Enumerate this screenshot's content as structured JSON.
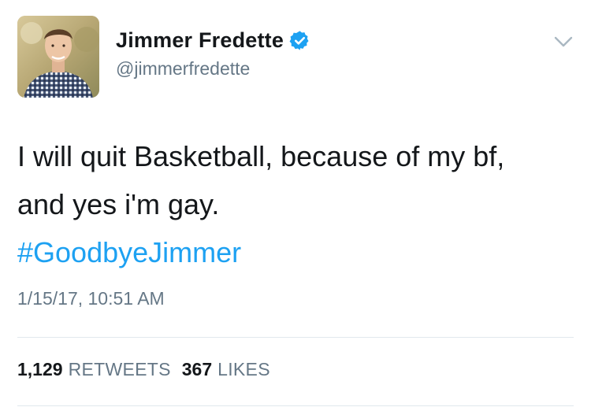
{
  "author": {
    "display_name": "Jimmer Fredette",
    "handle": "@jimmerfredette",
    "verified": true,
    "avatar_icon": "profile-photo"
  },
  "tweet": {
    "text_line1": "I will quit Basketball, because of my bf,",
    "text_line2": "and yes i'm gay.",
    "hashtag": "#GoodbyeJimmer",
    "timestamp": "1/15/17, 10:51 AM"
  },
  "stats": {
    "retweets_count": "1,129",
    "retweets_label": "RETWEETS",
    "likes_count": "367",
    "likes_label": "LIKES"
  },
  "colors": {
    "link": "#1da1f2",
    "verified_badge": "#1da1f2",
    "muted_text": "#657786",
    "primary_text": "#14171a",
    "divider": "#e1e8ed"
  }
}
